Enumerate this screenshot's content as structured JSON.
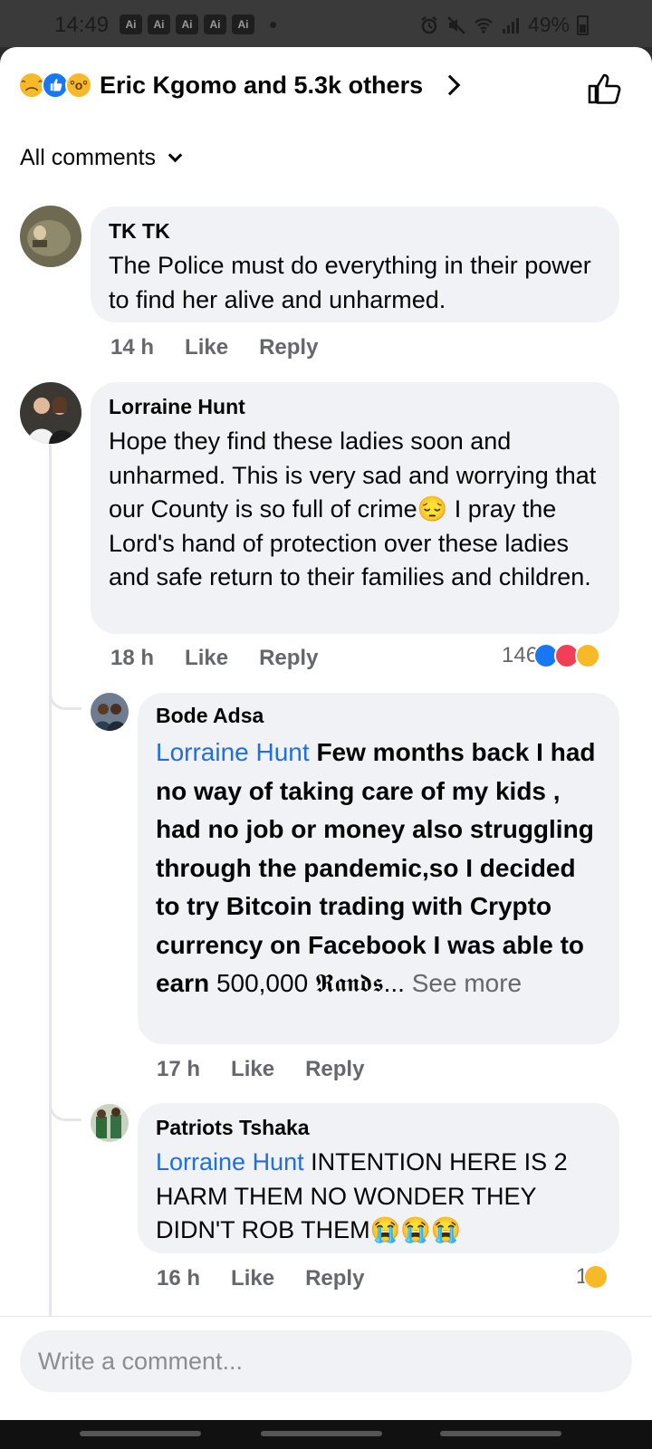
{
  "status_bar": {
    "time": "14:49",
    "ai_badges": [
      "Ai",
      "Ai",
      "Ai",
      "Ai",
      "Ai"
    ],
    "battery": "49%",
    "icons": [
      "alarm-icon",
      "mute-icon",
      "wifi-icon",
      "signal-icon",
      "battery-icon"
    ]
  },
  "header": {
    "reactions": [
      "sad",
      "like",
      "wow"
    ],
    "reactors_text": "Eric Kgomo and 5.3k others",
    "like_icon": "thumbs-up-outline-icon"
  },
  "filter": {
    "label": "All comments"
  },
  "comments": [
    {
      "name": "TK TK",
      "text": "The Police must do everything in their power to find her alive and unharmed.",
      "time": "14 h",
      "like": "Like",
      "reply": "Reply"
    },
    {
      "name": "Lorraine Hunt",
      "text": "Hope they find these ladies soon and unharmed. This is very sad and worrying that our County is so full of crime😔 I pray the Lord's hand of protection over these ladies and safe return to their families and children.",
      "time": "18 h",
      "like": "Like",
      "reply": "Reply",
      "reaction_count": "146",
      "reaction_types": [
        "like",
        "love",
        "care"
      ],
      "replies": [
        {
          "name": "Bode Adsa",
          "mention": "Lorraine Hunt",
          "text_bold": "Few months back I had no way of taking care of my kids , had no job or money also struggling through the pandemic,so I decided to try Bitcoin trading with Crypto currency on Facebook I was able to earn",
          "text_plain": "500,000",
          "text_fancy": "𝕽𝖆𝖓𝖉𝖘",
          "ellipsis": "...",
          "see_more": "See more",
          "time": "17 h",
          "like": "Like",
          "reply": "Reply"
        },
        {
          "name": "Patriots Tshaka",
          "mention": "Lorraine Hunt",
          "text": "INTENTION HERE IS 2 HARM THEM NO WONDER THEY DIDN'T ROB THEM😭😭😭",
          "time": "16 h",
          "like": "Like",
          "reply": "Reply",
          "reaction_count": "1",
          "reaction_types": [
            "sad"
          ]
        }
      ]
    }
  ],
  "composer": {
    "placeholder": "Write a comment..."
  },
  "colors": {
    "link": "#216fdb",
    "bubble": "#f0f2f5",
    "meta": "#65676b",
    "like_blue": "#1877f2",
    "love_red": "#f33e58",
    "emoji_yellow": "#f7b928"
  }
}
